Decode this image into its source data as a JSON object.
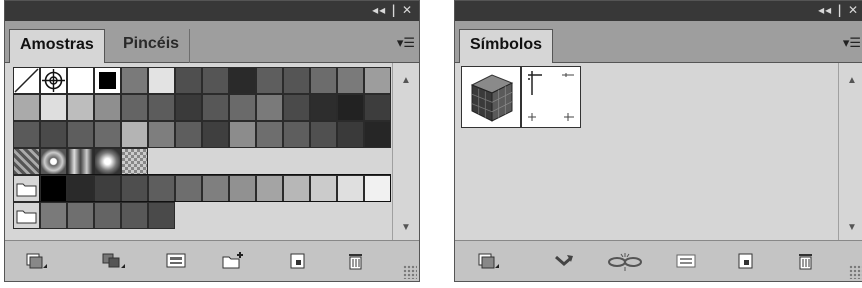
{
  "left_panel": {
    "controls": "◂◂ | ✕",
    "tabs": [
      {
        "label": "Amostras",
        "active": true
      },
      {
        "label": "Pincéis",
        "active": false
      }
    ],
    "menu_icon": "panel-menu-icon",
    "swatches": {
      "row1": [
        "none",
        "registration",
        "#ffffff",
        "#000000",
        "#7a7a7a",
        "#e3e3e3",
        "#4f4f4f",
        "#555555",
        "#2a2a2a",
        "#5e5e5e",
        "#555555",
        "#6c6c6c",
        "#7a7a7a",
        "#9d9d9d"
      ],
      "row2": [
        "#aaaaaa",
        "#dedede",
        "#bdbdbd",
        "#8f8f8f",
        "#646464",
        "#5c5c5c",
        "#3a3a3a",
        "#575757",
        "#6a6a6a",
        "#7a7a7a",
        "#4a4a4a",
        "#2d2d2d",
        "#222222",
        "#3d3d3d"
      ],
      "row3": [
        "#5a5a5a",
        "#4a4a4a",
        "#5e5e5e",
        "#6b6b6b",
        "#b4b4b4",
        "#7e7e7e",
        "#5e5e5e",
        "#3f3f3f",
        "#8c8c8c",
        "#6e6e6e",
        "#5e5e5e",
        "#505050",
        "#3a3a3a",
        "#262626"
      ],
      "patterns": [
        "pattern-diamond",
        "pattern-sphere",
        "gradient-linear",
        "gradient-radial",
        "pattern-checker"
      ],
      "group1": [
        "#000000",
        "#2a2a2a",
        "#3e3e3e",
        "#4e4e4e",
        "#5e5e5e",
        "#6e6e6e",
        "#7f7f7f",
        "#919191",
        "#a4a4a4",
        "#b7b7b7",
        "#cbcbcb",
        "#dfdfdf",
        "#f1f1f1"
      ],
      "group2": [
        "#7a7a7a",
        "#6f6f6f",
        "#646464",
        "#585858",
        "#4a4a4a"
      ]
    },
    "bottom_buttons": [
      "swatch-libraries-menu-icon",
      "show-swatch-kinds-icon",
      "swatch-options-icon",
      "new-color-group-icon",
      "new-swatch-icon",
      "delete-swatch-icon"
    ]
  },
  "right_panel": {
    "controls": "◂◂ | ✕",
    "tabs": [
      {
        "label": "Símbolos",
        "active": true
      }
    ],
    "menu_icon": "panel-menu-icon",
    "symbols": [
      "cube-symbol",
      "crop-marks-symbol"
    ],
    "bottom_buttons": [
      "symbol-libraries-menu-icon",
      "place-symbol-instance-icon",
      "break-link-icon",
      "symbol-options-icon",
      "new-symbol-icon",
      "delete-symbol-icon"
    ]
  }
}
